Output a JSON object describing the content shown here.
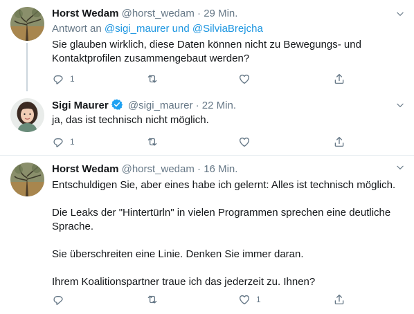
{
  "tweets": [
    {
      "name": "Horst Wedam",
      "handle": "@horst_wedam",
      "dot": "·",
      "time": "29 Min.",
      "reply_prefix": "Antwort an",
      "reply_user1": "@sigi_maurer",
      "reply_and": "und",
      "reply_user2": "@SilviaBrejcha",
      "lines": [
        "Sie glauben wirklich, diese Daten können nicht zu Bewegungs- und Kontaktprofilen zusammengebaut werden?"
      ],
      "reply_count": "1",
      "retweet_count": "",
      "like_count": ""
    },
    {
      "name": "Sigi Maurer",
      "handle": "@sigi_maurer",
      "dot": "·",
      "time": "22 Min.",
      "verified": true,
      "lines": [
        "ja, das ist technisch nicht möglich."
      ],
      "reply_count": "1",
      "retweet_count": "",
      "like_count": ""
    },
    {
      "name": "Horst Wedam",
      "handle": "@horst_wedam",
      "dot": "·",
      "time": "16 Min.",
      "lines": [
        "Entschuldigen Sie, aber eines habe ich gelernt: Alles ist technisch möglich.",
        "Die Leaks der \"Hintertürln\" in vielen Programmen sprechen eine deutliche Sprache.",
        "Sie überschreiten eine Linie. Denken Sie immer daran.",
        "Ihrem Koalitionspartner traue ich das jederzeit zu. Ihnen?"
      ],
      "reply_count": "",
      "retweet_count": "",
      "like_count": "1"
    }
  ],
  "colors": {
    "text": "#14171a",
    "secondary": "#657786",
    "link": "#1b95e0",
    "verified": "#1da1f2",
    "divider": "#e6ecf0"
  },
  "icons": {
    "reply": "reply-icon",
    "retweet": "retweet-icon",
    "like": "heart-icon",
    "share": "share-icon",
    "caret": "chevron-down-icon",
    "verified": "verified-badge-icon"
  }
}
